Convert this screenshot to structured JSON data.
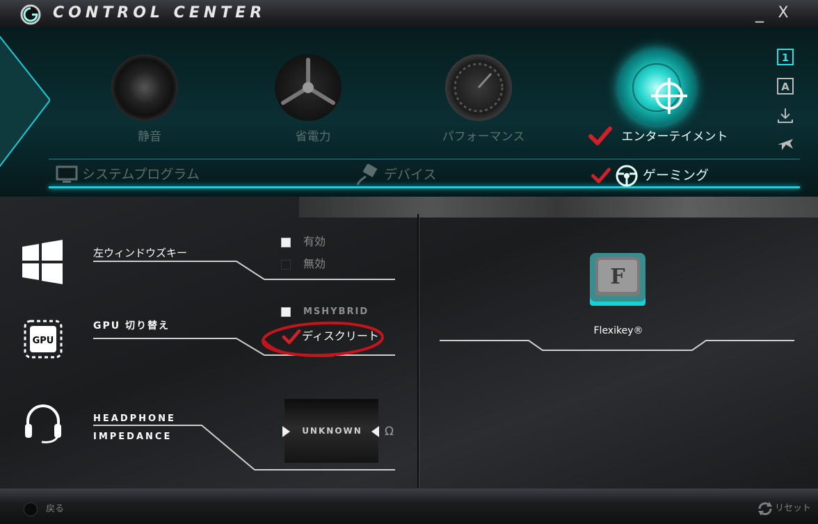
{
  "window": {
    "title": "CONTROL CENTER",
    "minimize_label": "_",
    "close_label": "X"
  },
  "modes": [
    {
      "label": "静音",
      "icon": "speaker-icon",
      "selected": false
    },
    {
      "label": "省電力",
      "icon": "fan-icon",
      "selected": false
    },
    {
      "label": "パフォーマンス",
      "icon": "speedometer-icon",
      "selected": false
    },
    {
      "label": "エンターテイメント",
      "icon": "crosshair-icon",
      "selected": true
    }
  ],
  "side_icons": [
    "profile-1-icon",
    "profile-a-icon",
    "download-icon",
    "airplane-icon"
  ],
  "subtabs": [
    {
      "label": "システムプログラム",
      "icon": "monitor-icon",
      "selected": false
    },
    {
      "label": "デバイス",
      "icon": "plug-icon",
      "selected": false
    },
    {
      "label": "ゲーミング",
      "icon": "steering-wheel-icon",
      "selected": true
    }
  ],
  "settings": {
    "left_windows_key": {
      "label": "左ウィンドウズキー",
      "options": [
        {
          "label": "有効",
          "checked": true
        },
        {
          "label": "無効",
          "checked": false
        }
      ]
    },
    "gpu_switch": {
      "label": "GPU 切り替え",
      "icon_text": "GPU",
      "options": [
        {
          "label": "MSHYBRID",
          "checked": true
        },
        {
          "label": "ディスクリート",
          "checked": true
        }
      ]
    },
    "headphone": {
      "label_line1": "HEADPHONE",
      "label_line2": "IMPEDANCE",
      "value": "UNKNOWN",
      "unit": "Ω"
    }
  },
  "flexikey": {
    "key_letter": "F",
    "label": "Flexikey®"
  },
  "bottom": {
    "back_label": "戻る",
    "reset_label": "リセット"
  },
  "colors": {
    "accent": "#1ad0d6",
    "check": "#d0202a",
    "annotation": "#c4141c"
  }
}
